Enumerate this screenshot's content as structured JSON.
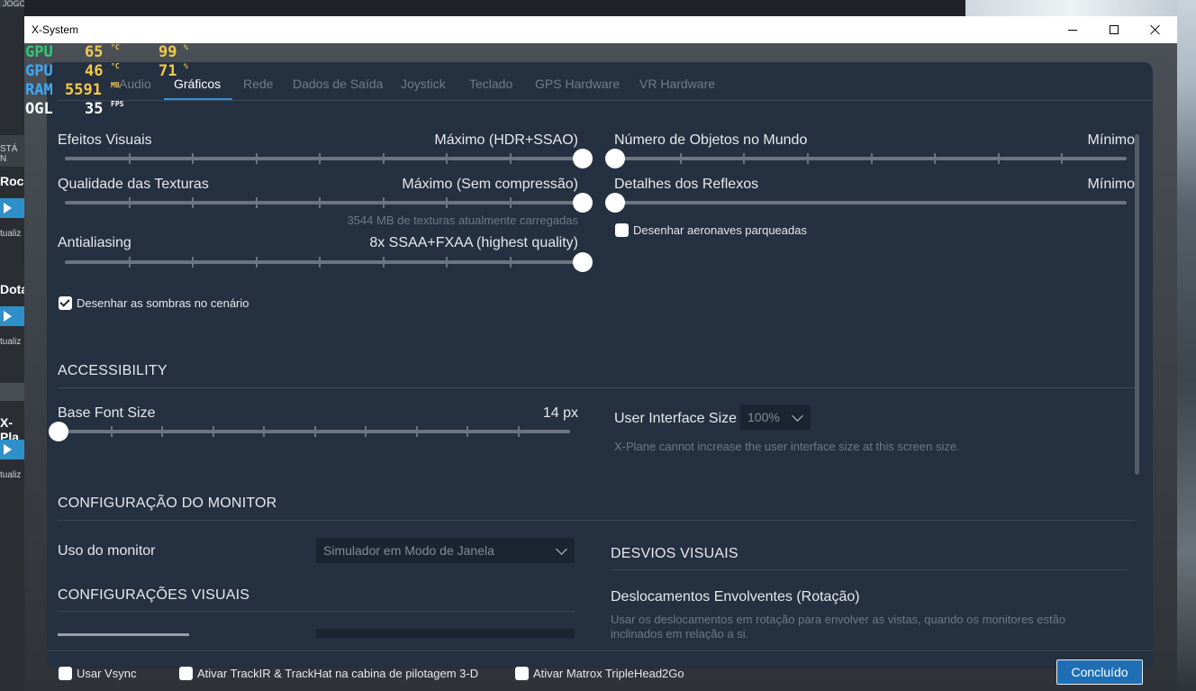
{
  "background": {
    "top_tab_label": "JOGOS",
    "side_items": [
      "STÁ N",
      "Rock",
      "tualiz",
      "Dota",
      "tualiz",
      "X-Pla",
      "tualiz"
    ]
  },
  "window": {
    "title": "X-System",
    "minimize_label": "",
    "maximize_label": "",
    "close_label": ""
  },
  "overlay": {
    "rows": [
      {
        "label": "GPU",
        "value": "65",
        "unit": "°C",
        "value2": "99",
        "unit2": "%"
      },
      {
        "label": "GPU",
        "value": "46",
        "unit": "°C",
        "value2": "71",
        "unit2": "%"
      },
      {
        "label": "RAM",
        "value": "5591",
        "unit": "MB"
      },
      {
        "label": "OGL",
        "value": "35",
        "unit": "FPS"
      }
    ]
  },
  "tabs": [
    "Audio",
    "Gráficos",
    "Rede",
    "Dados de Saída",
    "Joystick",
    "Teclado",
    "GPS Hardware",
    "VR Hardware"
  ],
  "active_tab": "Gráficos",
  "graphics": {
    "visual_effects": {
      "label": "Efeitos Visuais",
      "value": "Máximo (HDR+SSAO)",
      "level": 1.0
    },
    "texture_quality": {
      "label": "Qualidade das Texturas",
      "value": "Máximo (Sem compressão)",
      "level": 1.0,
      "note": "3544 MB de texturas atualmente carregadas"
    },
    "antialiasing": {
      "label": "Antialiasing",
      "value": "8x SSAA+FXAA (highest quality)",
      "level": 1.0
    },
    "draw_shadows": {
      "label": "Desenhar as sombras no cenário",
      "checked": true
    },
    "world_objects": {
      "label": "Número de Objetos no Mundo",
      "value": "Mínimo",
      "level": 0.0
    },
    "reflection_detail": {
      "label": "Detalhes dos Reflexos",
      "value": "Mínimo",
      "level": 0.0
    },
    "draw_parked_aircraft": {
      "label": "Desenhar aeronaves parqueadas",
      "checked": false
    }
  },
  "accessibility": {
    "heading": "ACCESSIBILITY",
    "base_font_size": {
      "label": "Base Font Size",
      "value": "14 px",
      "level": 0.0
    },
    "ui_size": {
      "label": "User Interface Size",
      "value": "100%",
      "note": "X-Plane cannot increase the user interface size at this screen size."
    }
  },
  "monitor": {
    "heading": "CONFIGURAÇÃO DO MONITOR",
    "usage": {
      "label": "Uso do monitor",
      "value": "Simulador em Modo de Janela"
    },
    "visual_heading": "CONFIGURAÇÕES VISUAIS",
    "offsets_heading": "DESVIOS VISUAIS",
    "rotation": {
      "label": "Deslocamentos Envolventes (Rotação)",
      "note": "Usar os deslocamentos em rotação para envolver as vistas, quando os monitores estão inclinados em relação a si."
    }
  },
  "footer": {
    "vsync": {
      "label": "Usar Vsync",
      "checked": false
    },
    "trackir": {
      "label": "Ativar TrackIR & TrackHat na cabina de pilotagem 3-D",
      "checked": false
    },
    "matrox": {
      "label": "Ativar Matrox TripleHead2Go",
      "checked": false
    },
    "done_label": "Concluído"
  },
  "colors": {
    "accent": "#1f6fb5",
    "dialog_bg": "#253040",
    "overlay_green": "#2ecc71",
    "overlay_blue": "#3fa9f5",
    "overlay_yellow": "#f2c94c"
  }
}
